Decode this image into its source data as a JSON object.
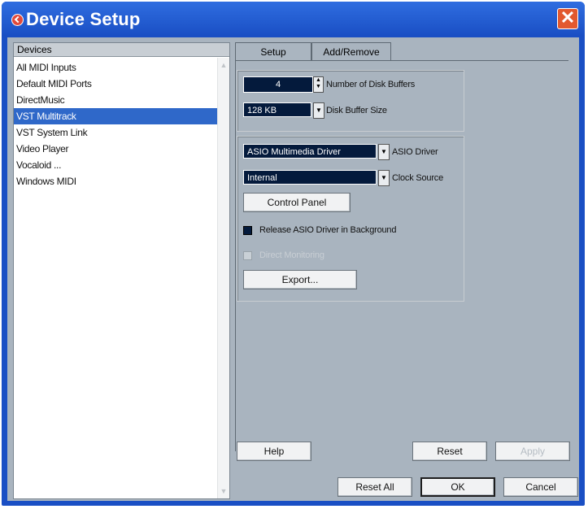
{
  "window": {
    "title": "Device Setup"
  },
  "devices": {
    "header": "Devices",
    "items": [
      {
        "label": "All MIDI Inputs",
        "selected": false
      },
      {
        "label": "Default MIDI Ports",
        "selected": false
      },
      {
        "label": "DirectMusic",
        "selected": false
      },
      {
        "label": "VST Multitrack",
        "selected": true
      },
      {
        "label": "VST System Link",
        "selected": false
      },
      {
        "label": "Video Player",
        "selected": false
      },
      {
        "label": "Vocaloid ...",
        "selected": false
      },
      {
        "label": "Windows MIDI",
        "selected": false
      }
    ]
  },
  "tabs": [
    {
      "label": "Setup",
      "active": true
    },
    {
      "label": "Add/Remove",
      "active": false
    }
  ],
  "disk": {
    "buffers_value": "4",
    "buffers_label": "Number of Disk Buffers",
    "buffer_size_value": "128 KB",
    "buffer_size_label": "Disk Buffer Size"
  },
  "asio": {
    "driver_value": "ASIO Multimedia Driver",
    "driver_label": "ASIO Driver",
    "clock_value": "Internal",
    "clock_label": "Clock Source",
    "control_panel": "Control Panel",
    "release_label": "Release ASIO Driver in Background",
    "monitoring_label": "Direct Monitoring",
    "export_label": "Export..."
  },
  "buttons": {
    "help": "Help",
    "reset": "Reset",
    "apply": "Apply",
    "reset_all": "Reset All",
    "ok": "OK",
    "cancel": "Cancel"
  },
  "colors": {
    "titlebar": "#1a4fc4",
    "client_bg": "#a9b4bf",
    "selected_row": "#2f68c9",
    "field_bg": "#041a3c"
  },
  "icons": [
    "app-logo-icon",
    "close-icon",
    "chevron-down-icon",
    "spin-arrows-icon"
  ]
}
